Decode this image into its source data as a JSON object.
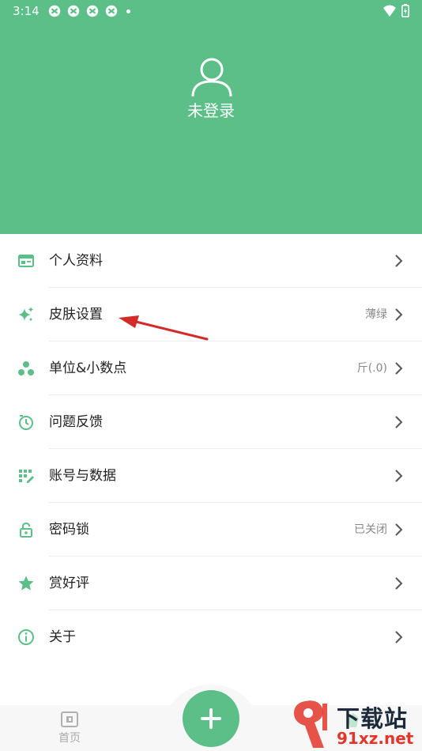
{
  "status_bar": {
    "time": "3:14"
  },
  "profile": {
    "login_label": "未登录"
  },
  "menu": [
    {
      "label": "个人资料",
      "value": "",
      "icon": "profile-card-icon"
    },
    {
      "label": "皮肤设置",
      "value": "薄绿",
      "icon": "sparkle-icon"
    },
    {
      "label": "单位&小数点",
      "value": "斤(.0)",
      "icon": "dots-icon"
    },
    {
      "label": "问题反馈",
      "value": "",
      "icon": "feedback-icon"
    },
    {
      "label": "账号与数据",
      "value": "",
      "icon": "data-icon"
    },
    {
      "label": "密码锁",
      "value": "已关闭",
      "icon": "lock-icon"
    },
    {
      "label": "赏好评",
      "value": "",
      "icon": "star-icon"
    },
    {
      "label": "关于",
      "value": "",
      "icon": "info-icon"
    }
  ],
  "tabbar": {
    "home_label": "首页"
  },
  "watermark": {
    "big": "下载站",
    "small": "91xz.net"
  },
  "colors": {
    "accent": "#5bbf87",
    "annotation_arrow": "#d42a2a"
  }
}
